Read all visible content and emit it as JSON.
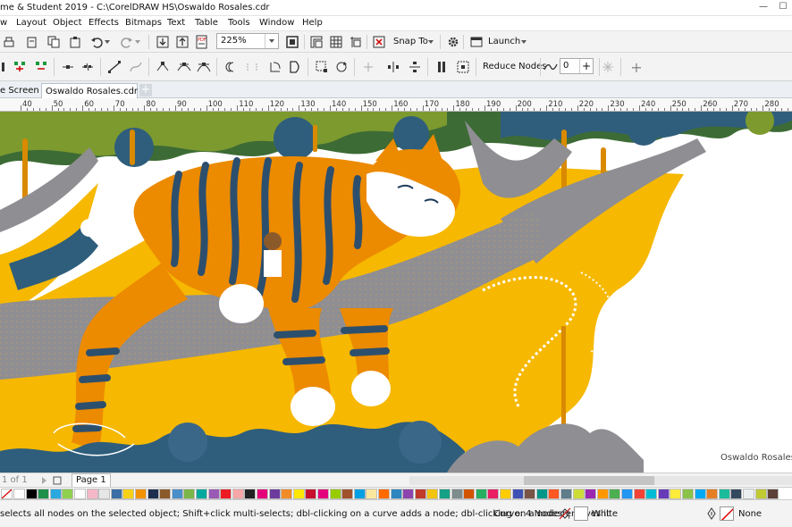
{
  "titlebar": {
    "title": "me & Student 2019 - C:\\CorelDRAW HS\\Oswaldo Rosales.cdr",
    "minimize": "—",
    "maximize": "☐"
  },
  "menubar": {
    "items": [
      "w",
      "Layout",
      "Object",
      "Effects",
      "Bitmaps",
      "Text",
      "Table",
      "Tools",
      "Window",
      "Help"
    ]
  },
  "standard_toolbar": {
    "zoom_value": "225%",
    "snap_to_label": "Snap To",
    "launch_label": "Launch"
  },
  "property_bar": {
    "reduce_nodes_label": "Reduce Nodes",
    "smoothing_value": "0"
  },
  "document_tabs": [
    {
      "label": "e Screen"
    },
    {
      "label": "Oswaldo Rosales.cdr"
    }
  ],
  "ruler": {
    "ticks": [
      "40",
      "50",
      "60",
      "70",
      "80",
      "90",
      "100",
      "110",
      "120",
      "130",
      "140",
      "150",
      "160",
      "170",
      "180",
      "190",
      "200",
      "210",
      "220",
      "230",
      "240",
      "250",
      "260",
      "270",
      "280"
    ]
  },
  "artwork": {
    "signature": "Oswaldo Rosales"
  },
  "page_navigator": {
    "page_of": "1 of 1",
    "page_tab": "Page 1"
  },
  "palette": {
    "colors": [
      "#ffffff",
      "#000000",
      "#1f8f4a",
      "#2aa9e0",
      "#8fd14f",
      "#ffffff",
      "#f5b8c8",
      "#e6e6e6",
      "#3a6ea5",
      "#f7d117",
      "#f39200",
      "#1d2f4f",
      "#8b5a2b",
      "#4a8fc9",
      "#7ab648",
      "#00a99d",
      "#9b59b6",
      "#ed1c24",
      "#f7a7a7",
      "#222222",
      "#e50079",
      "#6c3b9c",
      "#f28c28",
      "#ffe600",
      "#c8102e",
      "#e4007c",
      "#99cc00",
      "#a0522d",
      "#00a0e3",
      "#f9e79f",
      "#ff6a00",
      "#2e86c1",
      "#8e44ad",
      "#c0392b",
      "#f1c40f",
      "#16a085",
      "#7f8c8d",
      "#d35400",
      "#27ae60",
      "#e91e63",
      "#ffcc00",
      "#3f51b5",
      "#795548",
      "#009688",
      "#ff5722",
      "#607d8b",
      "#cddc39",
      "#9c27b0",
      "#ff9800",
      "#4caf50",
      "#2196f3",
      "#f44336",
      "#00bcd4",
      "#673ab7",
      "#ffeb3b",
      "#8bc34a",
      "#03a9f4",
      "#e67e22",
      "#1abc9c",
      "#34495e",
      "#ecf0f1",
      "#c0ca33",
      "#5d4037",
      "#fdd835",
      "#43a047",
      "#1e88e5",
      "#d81b60",
      "#fb8c00"
    ]
  },
  "status": {
    "hint": "selects all nodes on the selected object; Shift+click multi-selects; dbl-clicking on a curve adds a node; dbl-clicking on a node removes it",
    "object_info": "Curve: 4 Nodes",
    "fill_label": "White",
    "outline_label": "None"
  }
}
